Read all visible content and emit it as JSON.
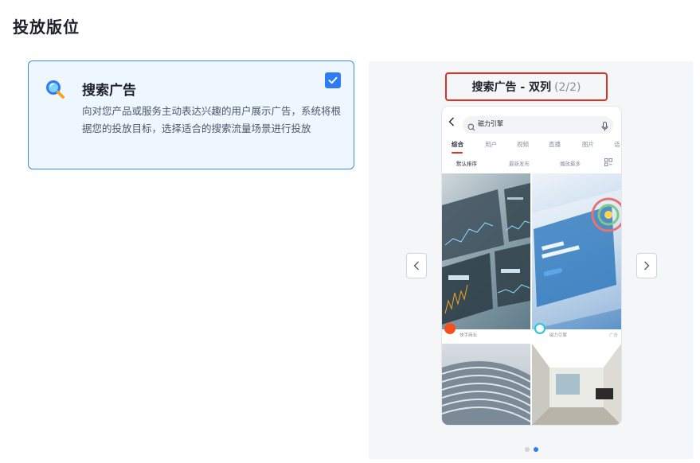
{
  "section": {
    "title": "投放版位"
  },
  "option": {
    "title": "搜索广告",
    "description": "向对您产品或服务主动表达兴趣的用户展示广告，系统将根据您的投放目标，选择适合的搜索流量场景进行投放",
    "checked": true,
    "icon": "magnifier-icon"
  },
  "preview": {
    "title": "搜索广告 - 双列",
    "counter": "(2/2)",
    "current_page": 2,
    "total_pages": 2,
    "phone": {
      "search_text": "磁力引擎",
      "tabs": [
        "综合",
        "用户",
        "视频",
        "直播",
        "图片",
        "话"
      ],
      "active_tab": "综合",
      "sort_options": [
        "默认排序",
        "最新发布",
        "播放最多"
      ],
      "active_sort": "默认排序",
      "tiles": [
        {
          "caption": "快手商业",
          "ad_label": "",
          "image": "analytics-dashboard",
          "avatar_color": "#f4511e"
        },
        {
          "caption": "磁力引擎",
          "ad_label": "广告",
          "image": "magnetic-engine-banner",
          "avatar_color": "#26c6da"
        },
        {
          "caption": "",
          "ad_label": "",
          "image": "curved-building"
        },
        {
          "caption": "",
          "ad_label": "",
          "image": "office-interior"
        }
      ],
      "banner_text": [
        "磁力引擎",
        "让品牌更有吸引力"
      ]
    }
  },
  "colors": {
    "accent": "#2f7bf5",
    "highlight_border": "#e03126",
    "card_bg": "#eef6ff"
  }
}
